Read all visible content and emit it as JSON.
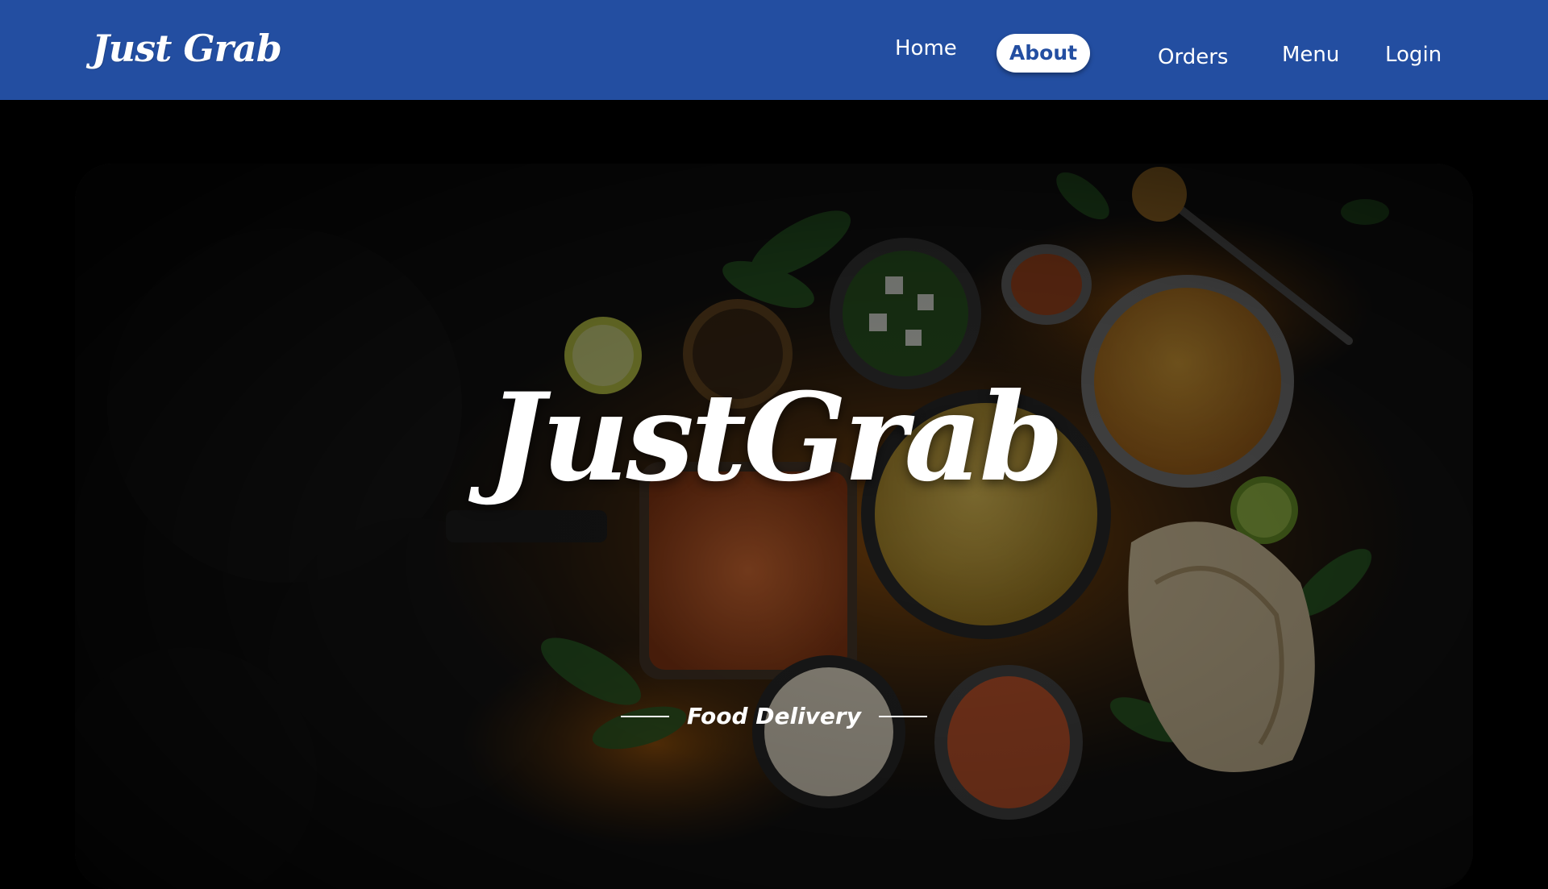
{
  "header": {
    "logo_text": "Just Grab",
    "nav": {
      "home": "Home",
      "about": "About",
      "orders": "Orders",
      "menu": "Menu",
      "login": "Login"
    },
    "active_item": "About"
  },
  "hero": {
    "title": "JustGrab",
    "subtitle": "Food Delivery",
    "image": "indian-food-spread-photo"
  },
  "colors": {
    "nav_bg": "#234ea1",
    "page_bg": "#000000",
    "text": "#ffffff",
    "active_pill": "#ffffff",
    "active_text": "#234ea1"
  }
}
